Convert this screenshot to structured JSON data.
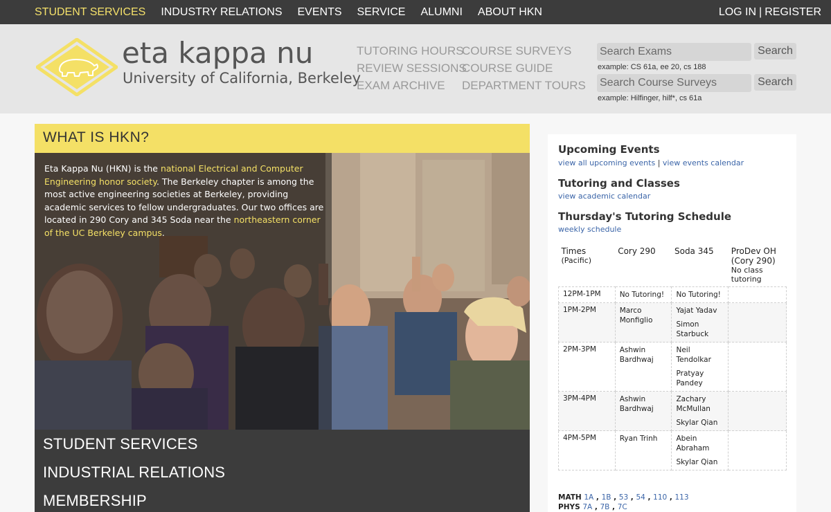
{
  "topnav": {
    "items": [
      "STUDENT SERVICES",
      "INDUSTRY RELATIONS",
      "EVENTS",
      "SERVICE",
      "ALUMNI",
      "ABOUT HKN"
    ],
    "login": "LOG IN",
    "separator": "|",
    "register": "REGISTER"
  },
  "brand": {
    "title": "eta kappa nu",
    "subtitle": "University of California, Berkeley"
  },
  "header_links": {
    "col1": [
      "TUTORING HOURS",
      "REVIEW SESSIONS",
      "EXAM ARCHIVE"
    ],
    "col2": [
      "COURSE SURVEYS",
      "COURSE GUIDE",
      "DEPARTMENT TOURS"
    ]
  },
  "search": {
    "exams_placeholder": "Search Exams",
    "exams_button": "Search",
    "exams_example": "example: CS 61a, ee 20, cs 188",
    "surveys_placeholder": "Search Course Surveys",
    "surveys_button": "Search",
    "surveys_example": "example: Hilfinger, hilf*, cs 61a"
  },
  "main": {
    "heading": "WHAT IS HKN?",
    "intro_1": "Eta Kappa Nu (HKN) is the ",
    "intro_link_1": "national Electrical and Computer Engineering honor society",
    "intro_2": ". The Berkeley chapter is among the most active engineering societies at Berkeley, providing academic services to fellow undergraduates. Our two offices are located in 290 Cory and 345 Soda near the ",
    "intro_link_2": "northeastern corner of the UC Berkeley campus",
    "intro_3": ".",
    "menu": [
      "STUDENT SERVICES",
      "INDUSTRIAL RELATIONS",
      "MEMBERSHIP"
    ]
  },
  "sidebar": {
    "upcoming_title": "Upcoming Events",
    "upcoming_link_1": "view all upcoming events",
    "upcoming_sep": "|",
    "upcoming_link_2": "view events calendar",
    "tutoring_title": "Tutoring and Classes",
    "tutoring_link": "view academic calendar",
    "schedule_title": "Thursday's Tutoring Schedule",
    "schedule_link": "weekly schedule",
    "table_headers": {
      "times": "Times",
      "times_sub": "(Pacific)",
      "cory": "Cory 290",
      "soda": "Soda 345",
      "prodev": "ProDev OH (Cory 290)",
      "prodev_sub": "No class tutoring"
    },
    "rows": [
      {
        "time": "12PM-1PM",
        "cory": [
          "No Tutoring!"
        ],
        "soda": [
          "No Tutoring!"
        ]
      },
      {
        "time": "1PM-2PM",
        "cory": [
          "Marco Monfiglio"
        ],
        "soda": [
          "Yajat Yadav",
          "Simon Starbuck"
        ]
      },
      {
        "time": "2PM-3PM",
        "cory": [
          "Ashwin Bardhwaj"
        ],
        "soda": [
          "Neil Tendolkar",
          "Pratyay Pandey"
        ]
      },
      {
        "time": "3PM-4PM",
        "cory": [
          "Ashwin Bardhwaj"
        ],
        "soda": [
          "Zachary McMullan",
          "Skylar Qian"
        ]
      },
      {
        "time": "4PM-5PM",
        "cory": [
          "Ryan Trinh"
        ],
        "soda": [
          "Abein Abraham",
          "Skylar Qian"
        ]
      }
    ],
    "math_label": "MATH",
    "math_courses": [
      "1A",
      "1B",
      "53",
      "54",
      "110",
      "113"
    ],
    "phys_label": "PHYS",
    "phys_courses": [
      "7A",
      "7B",
      "7C"
    ]
  },
  "colors": {
    "accent_yellow": "#f4e066",
    "dark_bar": "#3c3c3c",
    "link_blue": "#3b65a8"
  }
}
